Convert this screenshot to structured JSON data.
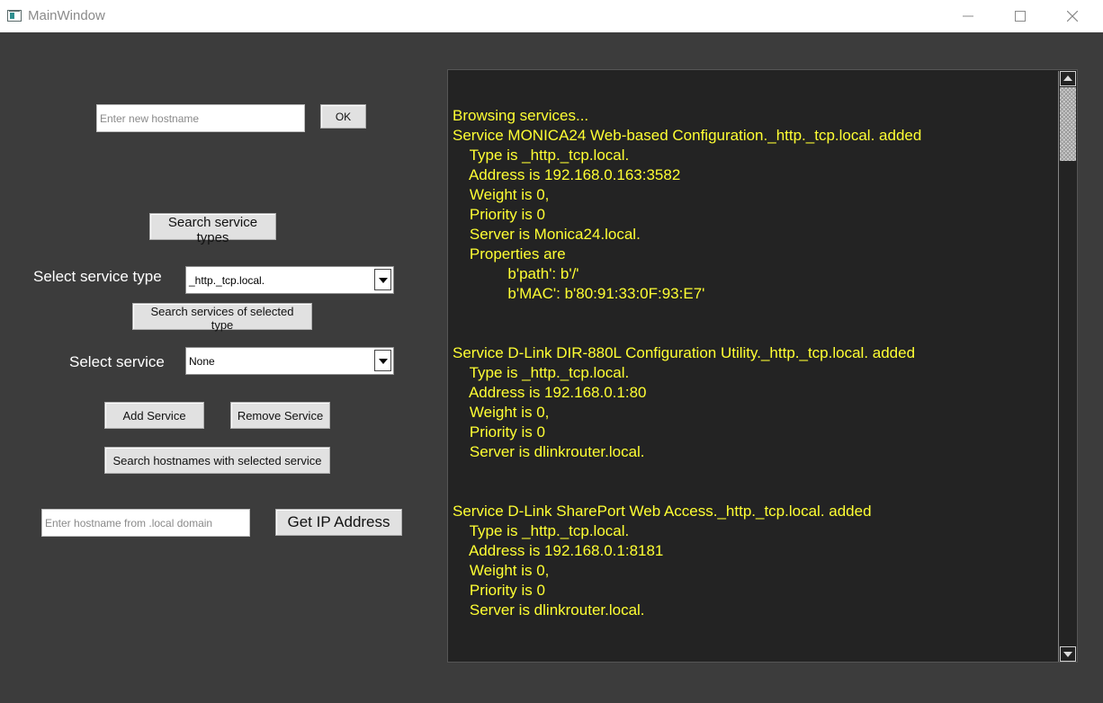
{
  "window": {
    "title": "MainWindow"
  },
  "hostname": {
    "placeholder": "Enter new hostname",
    "ok_label": "OK"
  },
  "search_types_label": "Search service types",
  "service_type": {
    "label": "Select service type",
    "selected": "_http._tcp.local."
  },
  "search_selected_label": "Search services of selected type",
  "service": {
    "label": "Select service",
    "selected": "None"
  },
  "add_service_label": "Add Service",
  "remove_service_label": "Remove Service",
  "search_hostnames_label": "Search hostnames with selected service",
  "resolve": {
    "placeholder": "Enter hostname from .local domain",
    "button_label": "Get IP Address"
  },
  "log": {
    "text_color": "#ffff33",
    "lines": [
      "Browsing services...",
      "Service MONICA24 Web-based Configuration._http._tcp.local. added",
      "    Type is _http._tcp.local.",
      "    Address is 192.168.0.163:3582",
      "    Weight is 0,",
      "    Priority is 0",
      "    Server is Monica24.local.",
      "    Properties are",
      "             b'path': b'/'",
      "             b'MAC': b'80:91:33:0F:93:E7'",
      "",
      "",
      "Service D-Link DIR-880L Configuration Utility._http._tcp.local. added",
      "    Type is _http._tcp.local.",
      "    Address is 192.168.0.1:80",
      "    Weight is 0,",
      "    Priority is 0",
      "    Server is dlinkrouter.local.",
      "",
      "",
      "Service D-Link SharePort Web Access._http._tcp.local. added",
      "    Type is _http._tcp.local.",
      "    Address is 192.168.0.1:8181",
      "    Weight is 0,",
      "    Priority is 0",
      "    Server is dlinkrouter.local."
    ]
  }
}
